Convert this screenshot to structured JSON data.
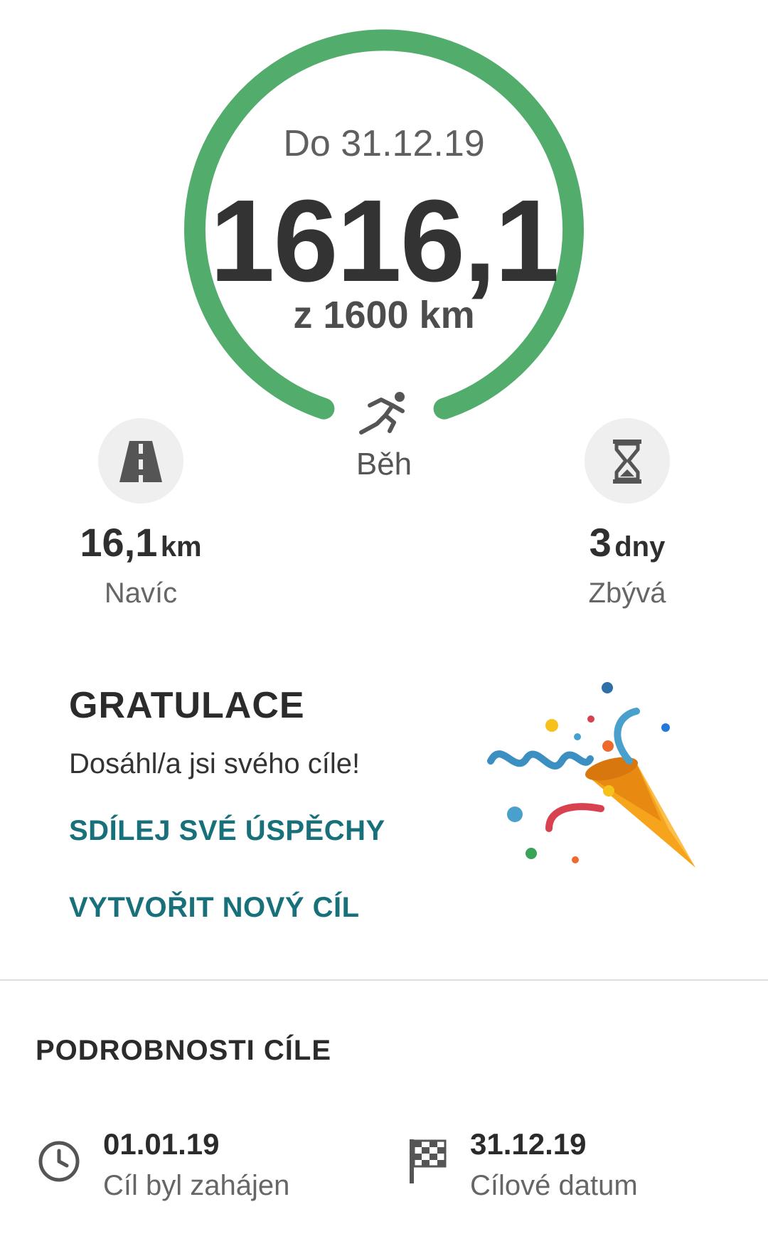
{
  "goal": {
    "deadline_text": "Do 31.12.19",
    "progress_value": "1616,1",
    "target_text": "z 1600 km",
    "progress_fraction": 1.0,
    "ring_color": "#52ad6c",
    "activity_icon": "running-icon",
    "activity_label": "Běh"
  },
  "stats": {
    "extra": {
      "icon": "road-icon",
      "value": "16,1",
      "unit": "km",
      "label": "Navíc"
    },
    "remaining": {
      "icon": "hourglass-icon",
      "value": "3",
      "unit": "dny",
      "label": "Zbývá"
    }
  },
  "congrats": {
    "title": "GRATULACE",
    "message": "Dosáhl/a jsi svého cíle!",
    "share_label": "SDÍLEJ SVÉ ÚSPĚCHY",
    "new_goal_label": "VYTVOŘIT NOVÝ CÍL",
    "link_color": "#17707a",
    "illustration_icon": "party-popper-icon"
  },
  "details": {
    "title": "PODROBNOSTI CÍLE",
    "start": {
      "icon": "clock-icon",
      "value": "01.01.19",
      "label": "Cíl byl zahájen"
    },
    "end": {
      "icon": "checkered-flag-icon",
      "value": "31.12.19",
      "label": "Cílové datum"
    }
  }
}
